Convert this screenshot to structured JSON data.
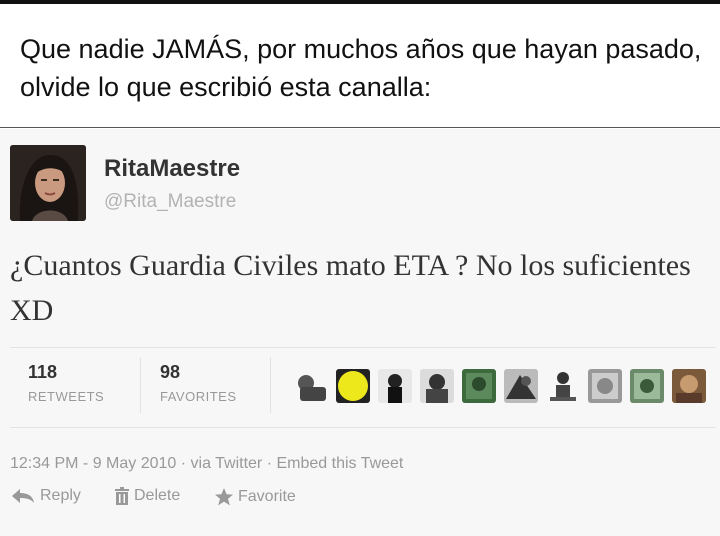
{
  "caption": {
    "text": "Que nadie JAMÁS, por muchos años que hayan pasado, olvide lo que escribió esta canalla:"
  },
  "tweet": {
    "display_name": "RitaMaestre",
    "handle": "@Rita_Maestre",
    "text": "¿Cuantos Guardia Civiles mato ETA ? No los suficientes XD",
    "retweets": {
      "count": "118",
      "label": "RETWEETS"
    },
    "favorites": {
      "count": "98",
      "label": "FAVORITES"
    },
    "timestamp": "12:34 PM - 9 May 2010",
    "via": " · via Twitter · ",
    "embed_label": "Embed this Tweet",
    "actions": {
      "reply": "Reply",
      "delete": "Delete",
      "favorite": "Favorite"
    },
    "favoriter_avatar_count": 10
  },
  "colors": {
    "name": "#333333",
    "muted": "#999999",
    "tweet_bg": "#f7f7f7"
  }
}
